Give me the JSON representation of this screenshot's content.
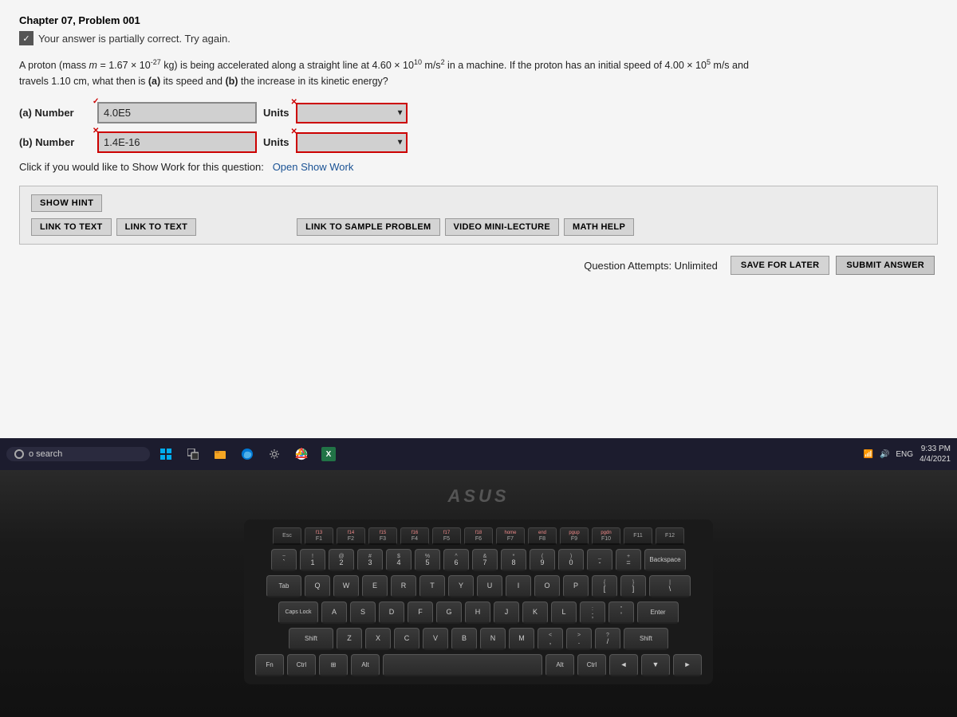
{
  "page": {
    "chapter": "Chapter 07, Problem 001",
    "status_message": "Your answer is partially correct. Try again.",
    "problem_text_line1": "A proton (mass m = 1.67 × 10",
    "problem_exp1": "-27",
    "problem_text_line1b": " kg) is being accelerated along a straight line at 4.60 × 10",
    "problem_exp2": "10",
    "problem_text_line1c": " m/s",
    "problem_exp3": "2",
    "problem_text_line1d": " in a machine. If the proton has an initial speed of 4.00 × 10",
    "problem_exp4": "5",
    "problem_text_line1e": " m/s and",
    "problem_text_line2": "travels 1.10 cm, what then is (a) its speed and (b) the increase in its kinetic energy?",
    "part_a": {
      "label": "(a) Number",
      "value": "4.0E5",
      "units_label": "Units"
    },
    "part_b": {
      "label": "(b) Number",
      "value": "1.4E-16",
      "units_label": "Units"
    },
    "show_work_text": "Click if you would like to Show Work for this question:",
    "show_work_link": "Open Show Work",
    "show_hint_label": "SHOW HINT",
    "link_to_text_1": "LINK TO TEXT",
    "link_to_text_2": "LINK TO TEXT",
    "link_sample": "LINK TO SAMPLE PROBLEM",
    "video_mini": "VIDEO MINI-LECTURE",
    "math_help": "MATH HELP",
    "attempts_label": "Question Attempts: Unlimited",
    "save_label": "SAVE FOR LATER",
    "submit_label": "SUBMIT ANSWER"
  },
  "taskbar": {
    "url": "edugen/shared/assignment/test/aglist.uni?id=...",
    "search_placeholder": "o search",
    "time": "9:33 PM",
    "date": "4/4/2021",
    "lang": "ENG"
  },
  "keyboard": {
    "fn_row": [
      {
        "top": "",
        "bottom": "Esc"
      },
      {
        "top": "f13",
        "bottom": "F1"
      },
      {
        "top": "f14",
        "bottom": "F2"
      },
      {
        "top": "f15",
        "bottom": "F3"
      },
      {
        "top": "f16",
        "bottom": "F4"
      },
      {
        "top": "f17",
        "bottom": "F5"
      },
      {
        "top": "f18",
        "bottom": "F6"
      },
      {
        "top": "home",
        "bottom": "F7"
      },
      {
        "top": "end",
        "bottom": "F8"
      },
      {
        "top": "pgup",
        "bottom": "F9"
      },
      {
        "top": "pgdn",
        "bottom": "F10"
      },
      {
        "top": "",
        "bottom": "F11"
      },
      {
        "top": "",
        "bottom": "F12"
      }
    ],
    "row1": [
      {
        "top": "~",
        "bottom": "`"
      },
      {
        "top": "!",
        "bottom": "1"
      },
      {
        "top": "@",
        "bottom": "2"
      },
      {
        "top": "#",
        "bottom": "3"
      },
      {
        "top": "$",
        "bottom": "4"
      },
      {
        "top": "%",
        "bottom": "5"
      },
      {
        "top": "^",
        "bottom": "6"
      },
      {
        "top": "&",
        "bottom": "7"
      },
      {
        "top": "*",
        "bottom": "8"
      },
      {
        "top": "(",
        "bottom": "9"
      },
      {
        "top": ")",
        "bottom": "0"
      },
      {
        "top": "_",
        "bottom": "-"
      },
      {
        "top": "+",
        "bottom": "="
      },
      {
        "top": "",
        "bottom": "Backspace"
      }
    ],
    "row2_labels": [
      "Tab",
      "Q",
      "W",
      "E",
      "R",
      "T",
      "Y",
      "U",
      "I",
      "O",
      "P",
      "[",
      "]",
      "\\"
    ],
    "row3_labels": [
      "Caps",
      "A",
      "S",
      "D",
      "F",
      "G",
      "H",
      "J",
      "K",
      "L",
      ";",
      "'",
      "Enter"
    ],
    "row4_labels": [
      "Shift",
      "Z",
      "X",
      "C",
      "V",
      "B",
      "N",
      "M",
      ",",
      ".",
      "/",
      "Shift"
    ],
    "row5_labels": [
      "Fn",
      "Ctrl",
      "Win",
      "Alt",
      "",
      "Alt",
      "Ctrl",
      "◄",
      "▼",
      "►"
    ]
  }
}
